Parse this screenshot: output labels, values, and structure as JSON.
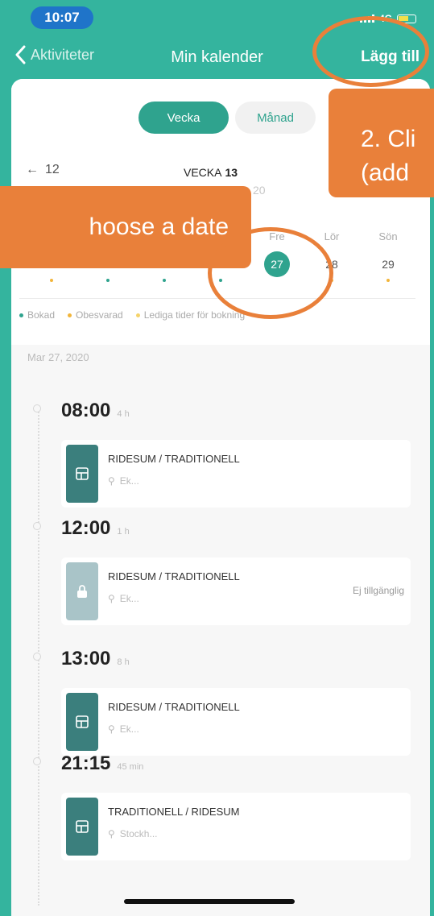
{
  "status": {
    "time": "10:07",
    "network": "4G"
  },
  "nav": {
    "back_label": "Aktiviteter",
    "title": "Min kalender",
    "add_label": "Lägg till"
  },
  "segment": {
    "week": "Vecka",
    "month": "Månad"
  },
  "week": {
    "prev": "12",
    "label": "VECKA",
    "number": "13",
    "year_partial": "20"
  },
  "days": [
    {
      "name": "",
      "num": "",
      "dot": "#f2b53a"
    },
    {
      "name": "",
      "num": "",
      "dot": "#2fa38e"
    },
    {
      "name": "",
      "num": "",
      "dot": "#2fa38e"
    },
    {
      "name": "",
      "num": "",
      "dot": "#2fa38e"
    },
    {
      "name": "Fre",
      "num": "27",
      "dot": "",
      "selected": true
    },
    {
      "name": "Lör",
      "num": "28",
      "dot": "#f2b53a"
    },
    {
      "name": "Sön",
      "num": "29",
      "dot": "#f2b53a"
    }
  ],
  "legend": [
    {
      "label": "Bokad",
      "color": "#2fa38e"
    },
    {
      "label": "Obesvarad",
      "color": "#f2b53a"
    },
    {
      "label": "Lediga tider för bokning",
      "color": "#f5d36a"
    }
  ],
  "date_heading": "Mar 27, 2020",
  "slots": [
    {
      "time": "08:00",
      "duration": "4 h",
      "name": "RIDESUM / TRADITIONELL",
      "location": "Ek...",
      "status": "",
      "locked": false
    },
    {
      "time": "12:00",
      "duration": "1 h",
      "name": "RIDESUM / TRADITIONELL",
      "location": "Ek...",
      "status": "Ej tillgänglig",
      "locked": true
    },
    {
      "time": "13:00",
      "duration": "8 h",
      "name": "RIDESUM / TRADITIONELL",
      "location": "Ek...",
      "status": "",
      "locked": false
    },
    {
      "time": "21:15",
      "duration": "45 min",
      "name": "TRADITIONELL / RIDESUM",
      "location": "Stockh...",
      "status": "",
      "locked": false
    }
  ],
  "callouts": {
    "choose_date": "hoose a date",
    "add_line1": "2. Cli",
    "add_line2": "(add"
  },
  "colors": {
    "brand": "#34b49e",
    "accent": "#2fa38e",
    "callout": "#e9803a"
  }
}
